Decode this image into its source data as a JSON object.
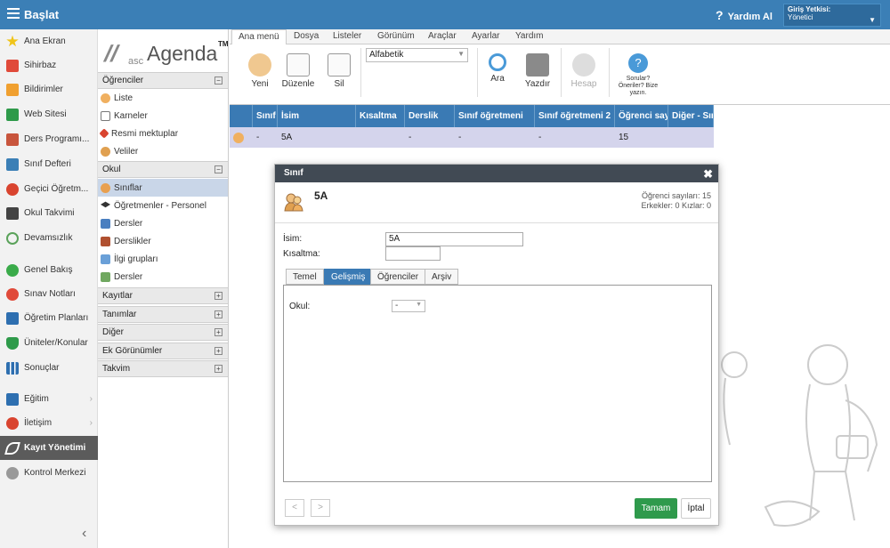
{
  "topbar": {
    "home": "Başlat",
    "help": "Yardım Al",
    "auth_title": "Giriş Yetkisi:",
    "auth_value": "Yönetici"
  },
  "sidebar": {
    "items": [
      "Ana Ekran",
      "Sihirbaz",
      "Bildirimler",
      "Web Sitesi",
      "Ders Programı...",
      "Sınıf Defteri",
      "Geçici Öğretm...",
      "Okul Takvimi",
      "Devamsızlık",
      "Genel Bakış",
      "Sınav Notları",
      "Öğretim Planları",
      "Üniteler/Konular",
      "Sonuçlar",
      "Eğitim",
      "İletişim",
      "Kayıt Yönetimi",
      "Kontrol Merkezi"
    ]
  },
  "logo": {
    "prefix": "asc",
    "name": "Agenda",
    "tm": "TM"
  },
  "panel": {
    "groups": [
      "Öğrenciler",
      "Okul",
      "Kayıtlar",
      "Tanımlar",
      "Diğer",
      "Ek Görünümler",
      "Takvim"
    ],
    "students_items": [
      "Liste",
      "Karneler",
      "Resmi mektuplar",
      "Veliler"
    ],
    "school_items": [
      "Sınıflar",
      "Öğretmenler - Personel",
      "Dersler",
      "Derslikler",
      "İlgi grupları",
      "Dersler"
    ]
  },
  "menu_tabs": [
    "Ana menü",
    "Dosya",
    "Listeler",
    "Görünüm",
    "Araçlar",
    "Ayarlar",
    "Yardım"
  ],
  "ribbon": {
    "new": "Yeni",
    "edit": "Düzenle",
    "delete": "Sil",
    "sort": "Alfabetik",
    "search": "Ara",
    "print": "Yazdır",
    "account": "Hesap",
    "questions": "Sorular? Öneriler? Bize yazın."
  },
  "grid": {
    "headers": [
      "Sınıf",
      "İsim",
      "Kısaltma",
      "Derslik",
      "Sınıf öğretmeni",
      "Sınıf öğretmeni 2",
      "Öğrenci sayısı",
      "Diğer - Sınıf"
    ],
    "row": [
      "-",
      "5A",
      "",
      "-",
      "-",
      "-",
      "15",
      ""
    ]
  },
  "dialog": {
    "title": "Sınıf",
    "name": "5A",
    "info1": "Öğrenci sayıları: 15",
    "info2": "Erkekler: 0 Kızlar: 0",
    "label_name": "İsim:",
    "value_name": "5A",
    "label_short": "Kısaltma:",
    "value_short": "",
    "tabs": [
      "Temel",
      "Gelişmiş",
      "Öğrenciler",
      "Arşiv"
    ],
    "school_label": "Okul:",
    "school_value": "-",
    "ok": "Tamam",
    "cancel": "İptal"
  },
  "colors": {
    "topbar": "#3b7fb6",
    "grid_header": "#3a7ab4",
    "selected_row": "#d4d4ec",
    "ok": "#2f9a4c"
  }
}
